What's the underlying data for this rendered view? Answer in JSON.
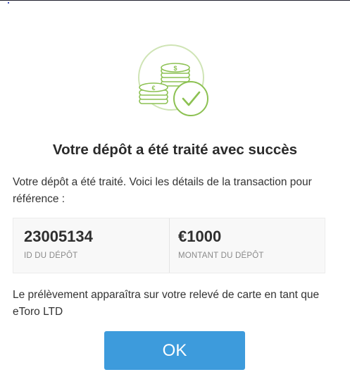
{
  "dialog": {
    "title": "Votre dépôt a été traité avec succès",
    "description": "Votre dépôt a été traité. Voici les détails de la transaction pour référence :",
    "details": {
      "deposit_id_value": "23005134",
      "deposit_id_label": "ID DU DÉPÔT",
      "amount_value": "€1000",
      "amount_label": "MONTANT DU DÉPÔT"
    },
    "note": "Le prélèvement apparaîtra sur votre relevé de carte en tant que eToro LTD",
    "ok_label": "OK"
  },
  "illustration": {
    "icon": "coins-with-checkmark-icon",
    "coin_symbols": [
      "$",
      "€"
    ]
  },
  "colors": {
    "accent_green": "#8cc152",
    "button_blue": "#3d9bdc",
    "title_text": "#2b2b2b",
    "label_gray": "#8a8a8a",
    "details_background": "#f8f8f8"
  }
}
